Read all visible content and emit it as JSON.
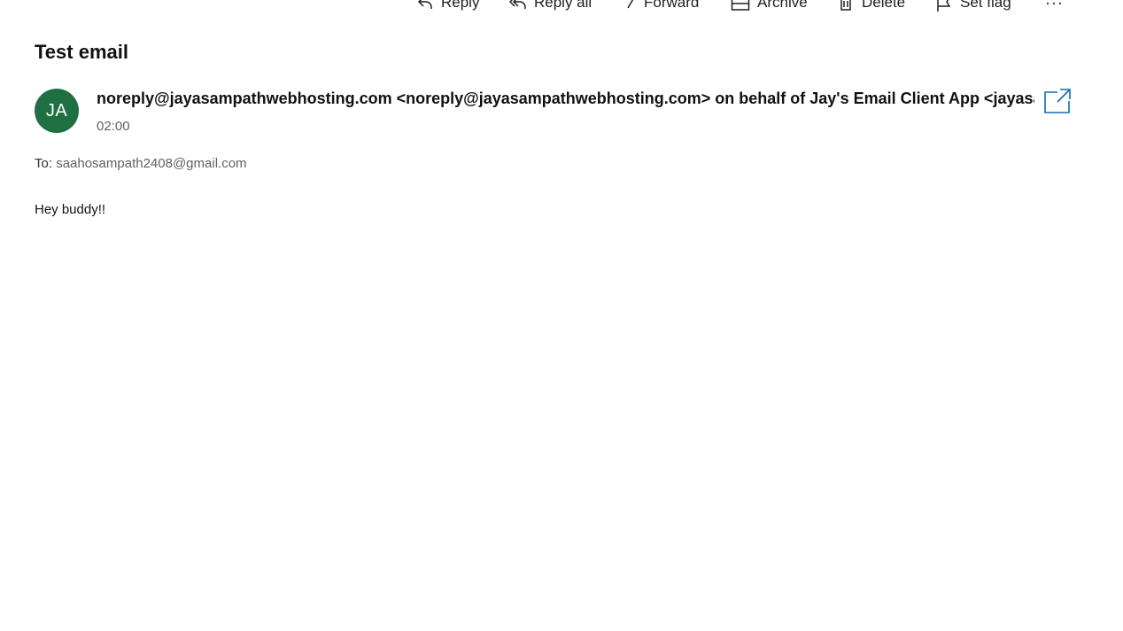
{
  "toolbar": {
    "reply_label": "Reply",
    "reply_all_label": "Reply all",
    "forward_label": "Forward",
    "archive_label": "Archive",
    "delete_label": "Delete",
    "set_flag_label": "Set flag",
    "more_label": "···"
  },
  "message": {
    "subject": "Test email",
    "avatar_initials": "JA",
    "avatar_color": "#1e6f42",
    "sender": "noreply@jayasampathwebhosting.com <noreply@jayasampathwebhosting.com> on behalf of Jay's Email Client App <jayasa",
    "time": "02:00",
    "to_label": "To:",
    "to_address": "saahosampath2408@gmail.com",
    "body": "Hey buddy!!"
  },
  "accent_color": "#0f6cbd"
}
